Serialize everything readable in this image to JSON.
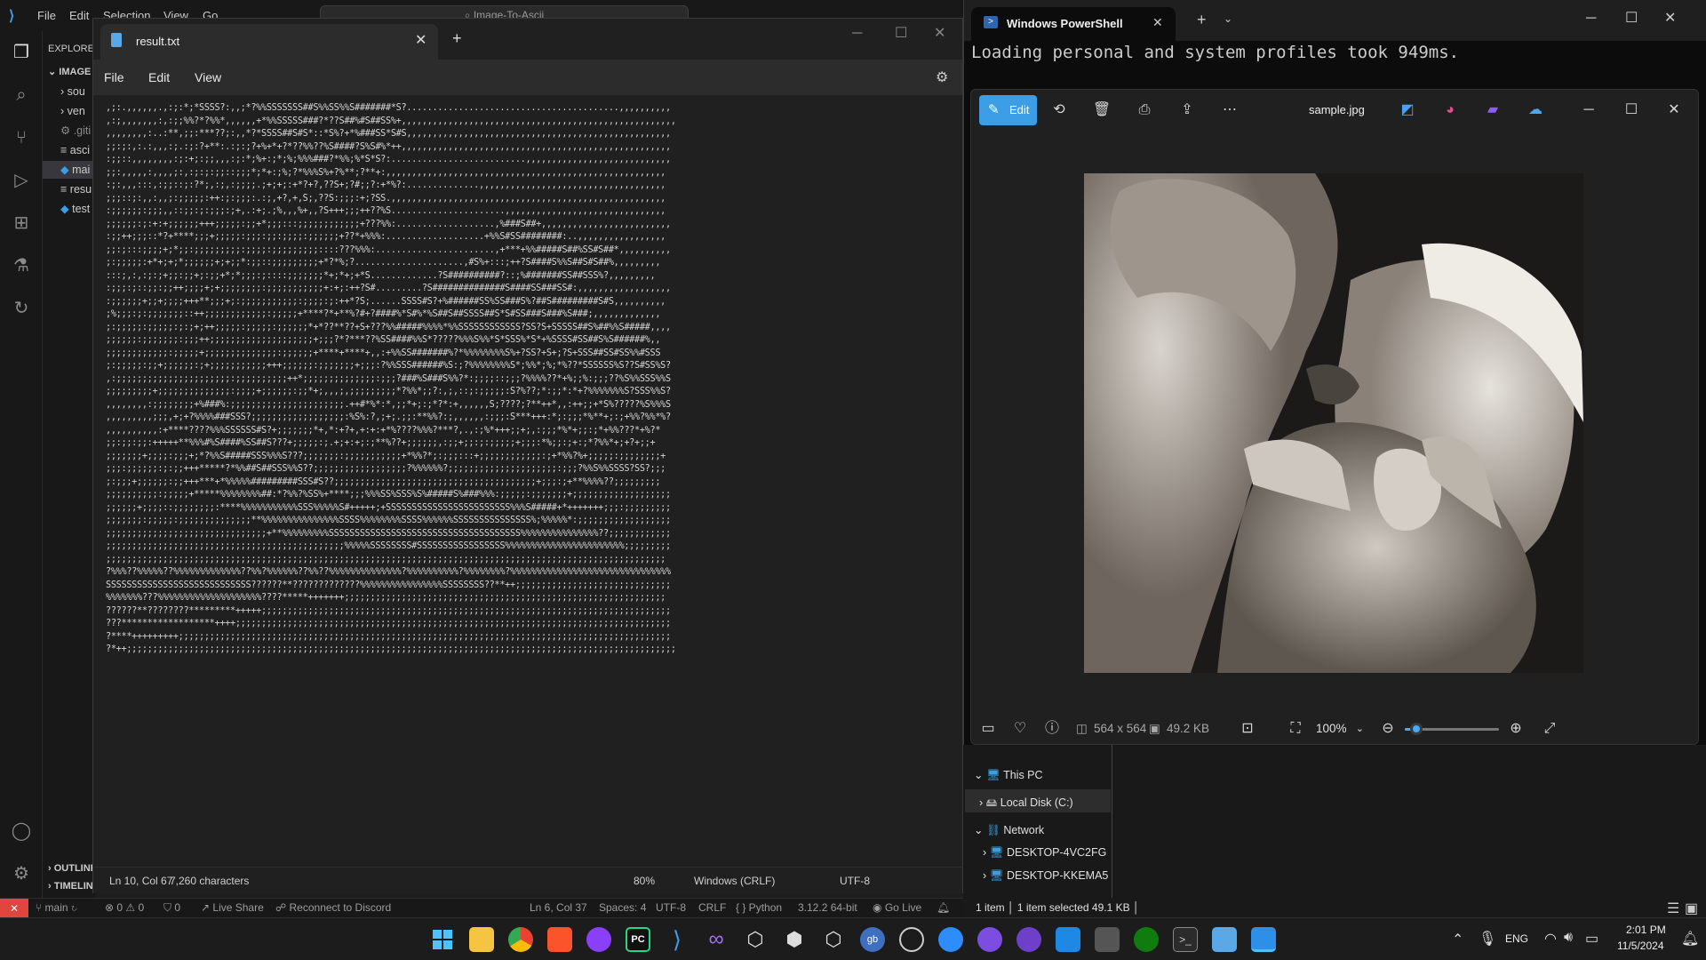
{
  "vscode": {
    "menu": [
      "File",
      "Edit",
      "Selection",
      "View",
      "Go",
      "..."
    ],
    "search_text": "Image-To-Ascii",
    "explorer_title": "EXPLORER",
    "explorer_section": "IMAGE",
    "explorer_items": [
      "sou",
      "ven",
      ".giti",
      "asci",
      "mai",
      "resu",
      "test"
    ],
    "outline": "OUTLINE",
    "timeline": "TIMELINE",
    "statusbar": {
      "branch": "main",
      "problems": "⊗ 0 ⚠ 0",
      "ports": "⛉ 0",
      "live_share": "Live Share",
      "discord": "Reconnect to Discord",
      "position": "Ln 6, Col 37",
      "spaces": "Spaces: 4",
      "encoding": "UTF-8",
      "eol": "CRLF",
      "language": "{ } Python",
      "interpreter": "3.12.2 64-bit",
      "go_live": "Go Live"
    }
  },
  "notepad": {
    "tab_title": "result.txt",
    "menu": [
      "File",
      "Edit",
      "View"
    ],
    "status": {
      "position": "Ln 10, Col 67",
      "chars": "7,260 characters",
      "zoom": "80%",
      "eol": "Windows (CRLF)",
      "encoding": "UTF-8"
    },
    "ascii_lines": [
      ",;:.,,,,,,.,:;:*;*SSSS?:,,;*?%%SSSSSSS##S%%SS%%S#######*S?.........................................,,,,,,,,,,",
      ",:;,,,,,,,:,:;;%%?*?%%*,,,,,,+*%%SSSSS###?*??S##%#S##SS%+,,,,,,,,,,,,,,,,,,,,,,,,,,,,,,,,,,,,,,,,,,,,,,,,,,,,,",
      ",,,,,,,,:..:**,;;:***??;:,,*?*SSSS##S#S*::*S%?+*%###SS*S#S,,,,,,,,,,,,,,,,,,,,,,,,,,,,,,,,,,,,,,,,,,,,,,,,,,,",
      ";;:;:,:.:,,,:;.:;:?+**:.:;:;?+%+*+?*??%%??%S####?S%S#%*++,,,,,,,,,,,,,,,,,,,,,,,,,,,,,,,,,,,,,,,,,,,,,,,,,,,,",
      ":;;::,,,,,,,,:;:+;:;;,,,:;:*;%+:;*;%;%%%###?*%%;%*S*S?:..........................,,,,,,,,,,,,,,,,,,,,,,,,,,,,",
      ";;:,,,,,:,,,,;:,:;:;:;;::;;;*;*+:;%;?*%%%S%+?%**;?**+:,,,,,,,,,,,,,,,,,,,,,,,,,,,,,,,,,,,,,,,,,,,,,,,,,,,,,,",
      ":;:,,,:::,:;;::;:?*;,:;,:;;;;.;+;+;:+*?+?,??S+;?#;;?:+*%?:..............,,,,,,,,,,,,,,,,,,,,,,,,,,,,,,,,,,,,",
      ";;;::;:,,:,,;:;;;;;:++:;:;;;:.:;,+?,+,S;,??S:;;;:+;?SS.,,,,,,,,,,,,,,,,,,,,,,,,,,,,,,,,,,,,,,,,,,,,,,,,,,,,,",
      ":;;;;;;:;;;,,::;;:;:;;;:;+,.:+;.;%,,,%+,,?S+++;;;++??%S......................,,,,,,,,,,,,,,,,,,,,,,,,,,,,,,,",
      ";;;;;;:;:+:+;;;;;;+++;;;;;:;;+*;;;:::;;;;;;;;;;;;+???%%:...................,%###S##+,,,,,,,,,,,,,,,,,,,,,,,,,",
      ":;;++;;;::*?+****;;;+;;;;;:;;;:;;:;;;;:;;;;;;+??*+%%%:...................+%%S#SS########:..,,,,,,,,,,,,,,,,,",
      ";;:;:::;;;;+;*;;:;;;;;;;;;:;;;;:;;;;;;;;;::::???%%%:.......................,+***+%%#####S##%SS#S##*,,,,,,,,,,",
      ";:;;;;;:+*+;+;*;;;;;;+;+;;*:;;::;;;;;;;;;+*?*%;?.....................,#S%+:::;++?S####S%%S##S#S##%,,,,,,,,,",
      ":::;,:,:;:;+;;:;;+;:;;+*;*;;;:;::::;;;;;;;*+;*+;+*S.............?S##########?::;%#######SS##SSS%?,,,,,,,,,",
      ":;;;:;::;;:;;++;;;;+;+;;;;;;;;:;;;;;;;;;;;+:+;:++?S#.........?S##############S####SS###SS#:,,,,,,,,,,,,,,,,,,",
      ":;;;;;;+;;+;;;;+++**;;;+;:;;;;;;;;;;;:;;;;:;:++*?S;......SSSS#S?+%######SS%SS###S%?##S#########S#S,,,,,,,,,,",
      ";%;;;:;:;;;;;;;::++;;;;;;;;;;;;:;;;;;+****?*+**%?#+?####%*S#%*%S##S##SSSS##S*S#SS###S###%S###;,,,,,,,,,,,,,",
      ";:;;;;;:;;;;;:;:;+;++;;;;;:;;;;;:;;;;;;*+*??**??+S+???%%#####%%%%*%%SSSSSSSSSSSS?SS?S+SSSSS##S%##%%S#####,,,,",
      ";;;;;;:;;;;;;;:;;;++;;;;;;;;;;;;;;;;;;;;+;;;?*?***??%SS####%%S*?????%%%S%%*S*SSS%*S*+%SSSS#SS##S%S######%,,",
      ";;;;;;;;;;;;:;;;;;+;;;;;;;;;;;;;;:;;;;;;+****+****+,,:+%%SS#######%?*%%%%%%%%S%+?SS?+S+;?S+SSS##SS#SS%%#SSS",
      ";:;;;;;:;;+;;;;;;:;+;;;;;;;;;;;+++;;;;;;:;;;;;;;+;;;:?%%SSS######%S:;?%%%%%%%%S*;%%*;%;*%??*SSSSSS%S??S#SS%S?",
      ",:;;;;;;;;;;;;;;;;;;;;;;:;;;;;;;;;;++*;;;;;;;;;;;;;;:;;;?###%S###S%%?*:;;;;::;;;?%%%%??*+%;;%:;;;??%S%%SSS%%S",
      ";;;;;;;;;+;;;;;;;;;;;;;;:;;;;+;;;;;;:;;*+;,,,;,;;;;;;;;;*?%%*;;?:,;,::;:;;;;;:S?%??;*:;;*:*+?%%%%%%%S?SSS%%S?",
      ",,,,,,,,:;;;;;;;;+%###%:;;;;;;;;;;;;;;;;;;;;;;.++#*%*:*,;;*+;:;*?*:+,,,,,,S;????;?**++*,,:++;;+*S%?????%S%%%S",
      ",,,,,,,,,;;;,+;+?%%%%###SSS?;;;;;;;;;;;;;;;;;;:%S%:?,;+;.;;:**%%?:;,,,,,,:;;;:S***+++:*;:;;;*%**+;:;+%%?%%*%?",
      ",,,,,,,,,,:+****????%%%SSSSSS#S?+;;;;;;;*+,*:+?+,+:+:+*%????%%%?***?,.,:;%*+++;;+;,:;;;*%*+;;:;*+%%???*+%?*",
      ";;:;;:;;:+++++**%%%#%S####%SS##S???+;;;;;:;.+;+:+;:;**%??+;;;;;;,:;;+;;:;:;;;;;+;;;:*%;;:;+:;*?%%*+;+?+;;+",
      ";;;;;;;+;;;;:;;;+;*?%%S#####SSS%%%S???;;;;;;;:;;;;;;;;;;;+*%%?*;:;;;:::+;;;;;;;;;;;;:;+*%%?%+;;;;;:;;;;;;;;+",
      ";;;:;;;;;;:;:;;+++*****?*%%##S##SSS%%S??;;;;;;;;;;;;;;;;;;?%%%%%%?;;;;;;;;;;;;;;;;;;;;;:;;;?%%S%%SSSS?SS?;;;",
      ";:;;;+;;;;;;:;;+++***+*%%%%%#########SSS#S??;;;;;;;;;;;;;;;;;;;;;;;;;;;;;;;;;;;;;;;+;;;:;+**%%%%??;;;;;;;;;",
      ";;;;;;;;;;:;;;;;+*****%%%%%%%%##:*?%%?%SS%+****;;;%%%SS%SSS%S%#####S%###%%%:;;;;;:;;;;;;;+;;;;;;;;;;;;;;;;;;;",
      ";;;;;;+;;;;::;;;;;;;;:****%%%%%%%%%%%SSS%%%%%S#+++++;+SSSSSSSSSSSSSSSSSSSSSSSS%%%S#####+*+++++++;;;:;;;;;;;;;",
      ";;;;;;;:;;;;;:;;;;;;;;;;;;;;**%%%%%%%%%%%%%%%SSSS%%%%%%%%SSSS%%%%%%SSSSSSSSSSSSSSS%;%%%%%*:;;;;;;;;;;;;;;;;;;",
      ";;;;;;;;;;;;;;;;;;;;;;;;;;;;;;;+**%%%%%%%%%SSSSSSSSSSSSSSSSSSSSSSSSSSSSSSSSSSSSS%%%%%%%%%%%%%%%??;;;;;;;;;;;;",
      ";;;;;;;;;;;;;;;;;;;;;;;;;;;;;;;;;;;;;;;;;;;;;;%%%%%SSSSSSSS#SSSSSSSSSSSSSSSSS%%%%%%%%%%%%%%%%%%%%%%%;;;;;;;;;",
      ";;;;;;;;;;;;;;;;;;;;;;;;;;;;;;;;;;;;;;;;;;;;;;;;;;;;;;;;;;;;;;;;;;;;;;;;;;;;;;;;;;;;;;;;;;;;;;;;;;;;;;;;;;;;",
      "?%%%??%%%%%??%%%%%%%%%%%%%??%%?%%%%%%??%%??%%%%%%%%%%%%%%?%%%%%%%%%%?%%%%%%%%?%%%%%%%%%%%%%%%%%%%%%%%%%%%%%%%",
      "SSSSSSSSSSSSSSSSSSSSSSSSSSSS??????**?????????????%%%%%%%%%%%%%%%%SSSSSSSS??**++;;;;;;;;;;;;;;;;;;;;;;;;;;;;;;",
      "%%%%%%%???%%%%%%%%%%%%%%%%%%%%????*****+++++++;;;;;;;;;;;;;;;;;;;;;;;;;;;;;;;;;;;;;;;;;;;;;;;;;;;;;;;;;;;;;;",
      "??????**????????*********+++++;;;;;;;;;;;;;;;;;;;;;;;;;;;;;;;;;;;;;;;;;;;;;;;;;;;;;;;;;;;;;;;;;;;;;;;;;;;;;;;",
      "???******************++++;;;;;;;;;;;;;;;;;;;;;;;;;;;;;;;;;;;;;;;;;;;;;;;;;;;;;;;;;;;;;;;;;;;;;;;;;;;;;;;;;;;;",
      "?****+++++++++;;;;;;;;;;;;;;;;;;;;;;;;;;;;;;;;;;;;;;;;;;;;;;;;;;;;;;;;;;;;;;;;;;;;;;;;;;;;;;;;;;;;;;;;;;;;;;;",
      "?*++;;;;;;;;;;;;;;;;;;;;;;;;;;;;;;;;;;;;;;;;;;;;;;;;;;;;;;;;;;;;;;;;;;;;;;;;;;;;;;;;;;;;;;;;;;;;;;;;;;;;;;;;;;"
    ]
  },
  "powershell": {
    "tab_title": "Windows PowerShell",
    "output": "Loading personal and system profiles took 949ms."
  },
  "photos": {
    "edit_label": "Edit",
    "filename": "sample.jpg",
    "dimensions": "564 x 564",
    "filesize": "49.2 KB",
    "zoom": "100%",
    "zoom_fraction": 0.12
  },
  "file_explorer": {
    "tree": [
      "This PC",
      "Local Disk (C:)",
      "Network",
      "DESKTOP-4VC2FG",
      "DESKTOP-KKEMA5"
    ],
    "status_count": "1 item",
    "status_selected": "1 item selected  49.1 KB"
  },
  "taskbar": {
    "lang": "ENG",
    "time": "2:01 PM",
    "date": "11/5/2024",
    "apps": [
      "start",
      "explorer",
      "chrome",
      "brave",
      "obs",
      "pycharm",
      "vscode",
      "visualstudio",
      "unity",
      "box1",
      "box2",
      "gb",
      "steam",
      "zoom",
      "app1",
      "github",
      "app2",
      "app3",
      "xbox",
      "terminal",
      "notepad",
      "photos"
    ]
  }
}
